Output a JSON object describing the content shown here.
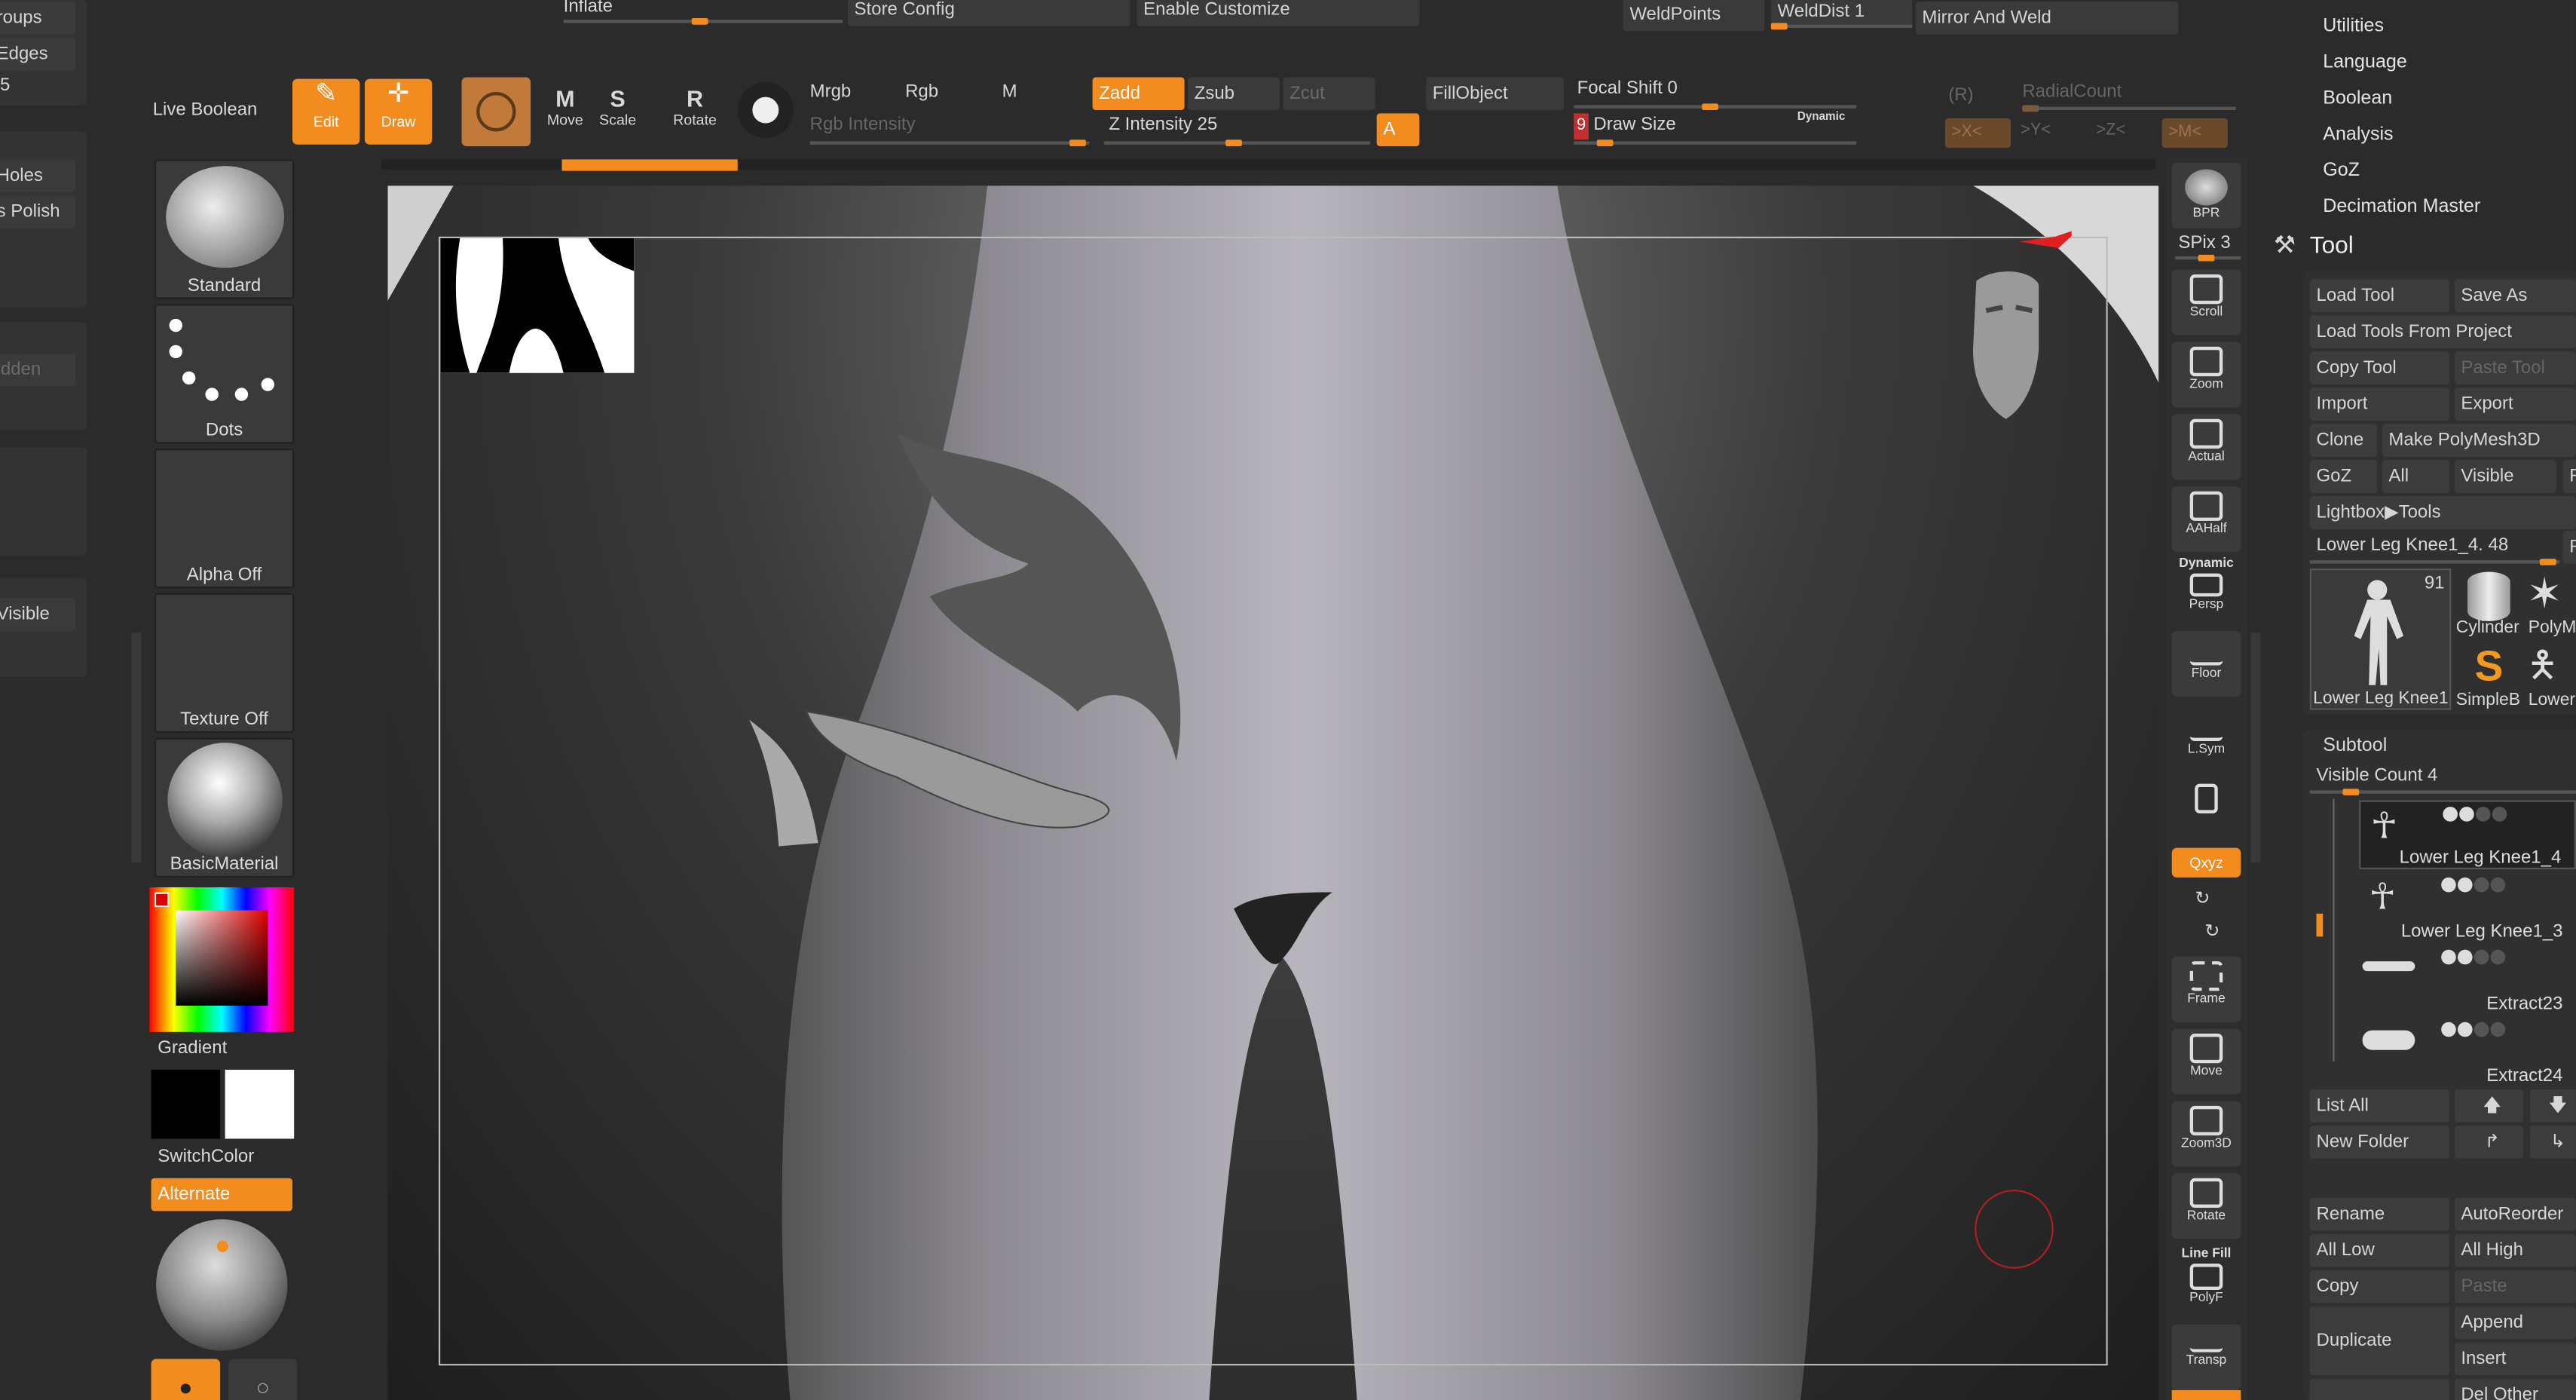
{
  "top": {
    "inflate": "Inflate",
    "store_config": "Store Config",
    "enable_customize": "Enable Customize",
    "weldpoints": "WeldPoints",
    "welddist": "WeldDist 1",
    "mirror_weld": "Mirror And Weld"
  },
  "left_edge": {
    "groups": "roups",
    "edges": "Edges",
    "n": "5",
    "holes": "Holes",
    "polish": "s Polish",
    "hidden": "idden",
    "visible": "Visible"
  },
  "toolbar": {
    "live_boolean": "Live Boolean",
    "edit": "Edit",
    "draw": "Draw",
    "move": "Move",
    "scale": "Scale",
    "rotate": "Rotate",
    "mrgb": "Mrgb",
    "rgb": "Rgb",
    "m": "M",
    "rgb_intensity": "Rgb Intensity",
    "zadd": "Zadd",
    "zsub": "Zsub",
    "zcut": "Zcut",
    "z_intensity": "Z Intensity 25",
    "a": "A",
    "fillobject": "FillObject",
    "focal_shift": "Focal Shift 0",
    "draw_size_num": "9",
    "draw_size": "Draw Size",
    "dynamic": "Dynamic",
    "r": "(R)",
    "radialcount": "RadialCount",
    "x": ">X<",
    "y": ">Y<",
    "z": ">Z<",
    "m2": ">M<"
  },
  "left_palette": {
    "standard": "Standard",
    "dots": "Dots",
    "alpha_off": "Alpha Off",
    "texture_off": "Texture Off",
    "basic_material": "BasicMaterial",
    "gradient": "Gradient",
    "switch_color": "SwitchColor",
    "alternate": "Alternate"
  },
  "shelf": {
    "bpr": "BPR",
    "spix": "SPix 3",
    "scroll": "Scroll",
    "zoom": "Zoom",
    "actual": "Actual",
    "aahalf": "AAHalf",
    "dynamic": "Dynamic",
    "persp": "Persp",
    "floor": "Floor",
    "lsym": "L.Sym",
    "xyz": "Qxyz",
    "frame": "Frame",
    "move": "Move",
    "zoom3d": "Zoom3D",
    "rotate": "Rotate",
    "line_fill": "Line Fill",
    "polyf": "PolyF",
    "transp": "Transp"
  },
  "menu": {
    "utilities": "Utilities",
    "language": "Language",
    "boolean": "Boolean",
    "analysis": "Analysis",
    "goz": "GoZ",
    "decimation": "Decimation Master",
    "tool": "Tool"
  },
  "tool": {
    "load_tool": "Load Tool",
    "save_as": "Save As",
    "load_from_project": "Load Tools From Project",
    "copy_tool": "Copy Tool",
    "paste_tool": "Paste Tool",
    "import": "Import",
    "export": "Export",
    "clone": "Clone",
    "make_polymesh": "Make PolyMesh3D",
    "goz": "GoZ",
    "all": "All",
    "visible": "Visible",
    "r": "R",
    "lightbox": "Lightbox▶Tools",
    "current": "Lower Leg Knee1_4. 48",
    "thumb_count": "91",
    "thumb_name": "Lower Leg Knee1",
    "cylinder": "Cylinder",
    "polym": "PolyM",
    "simpleb": "SimpleB",
    "lower": "Lower"
  },
  "subtool": {
    "title": "Subtool",
    "visible_count": "Visible Count 4",
    "items": [
      "Lower Leg Knee1_4",
      "Lower Leg Knee1_3",
      "Extract23",
      "Extract24"
    ],
    "list_all": "List All",
    "new_folder": "New Folder",
    "rename": "Rename",
    "autoreorder": "AutoReorder",
    "all_low": "All Low",
    "all_high": "All High",
    "copy": "Copy",
    "paste": "Paste",
    "append": "Append",
    "duplicate": "Duplicate",
    "insert": "Insert",
    "del_other": "Del Other"
  }
}
